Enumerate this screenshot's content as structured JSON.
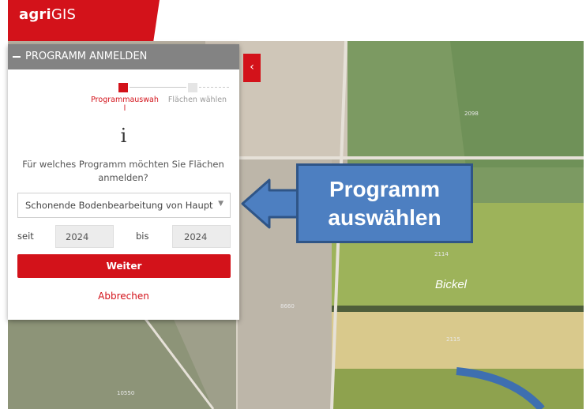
{
  "app": {
    "brand_bold": "agri",
    "brand_light": "GIS"
  },
  "panel": {
    "title": "PROGRAMM ANMELDEN",
    "steps": [
      {
        "label": "Programmauswahl"
      },
      {
        "label": "Flächen wählen"
      }
    ],
    "info_glyph": "i",
    "question": "Für welches Programm möchten Sie Flächen anmelden?",
    "program_select_value": "Schonende Bodenbearbeitung von Haupt",
    "since_label": "seit",
    "since_value": "2024",
    "until_label": "bis",
    "until_value": "2024",
    "next_button": "Weiter",
    "cancel_button": "Abbrechen"
  },
  "collapse_glyph": "‹",
  "map": {
    "parcel_labels": [
      "2098",
      "2114",
      "8660",
      "2115",
      "10550"
    ],
    "field_name": "Bickel"
  },
  "callout": {
    "line1": "Programm",
    "line2": "auswählen"
  },
  "colors": {
    "brand_red": "#d3121a",
    "callout_blue": "#4d7fc1",
    "panel_header": "#838383"
  }
}
